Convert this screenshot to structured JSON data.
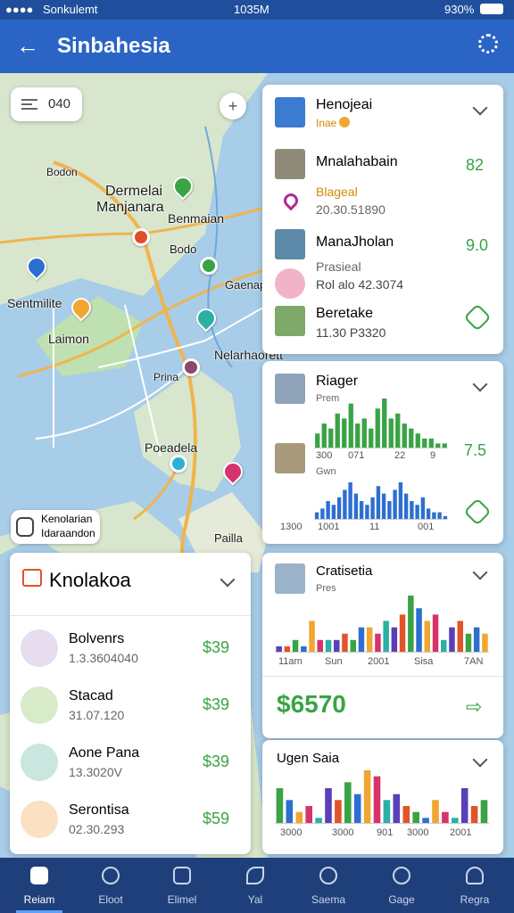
{
  "status_bar": {
    "carrier": "Sonkulemt",
    "time": "1035M",
    "battery": "930%"
  },
  "header": {
    "title": "Sinbahesia"
  },
  "map": {
    "search_text": "040",
    "labels": [
      "Bodon",
      "Dermelai",
      "Manjanara",
      "Benmaian",
      "Bodo",
      "Gaenapa",
      "Sentmilite",
      "Laimon",
      "Nelarhaorett",
      "Prina",
      "Poeadela",
      "Pailla"
    ],
    "layer_chip": {
      "line1": "Kenolarian",
      "line2": "Idaraandon"
    }
  },
  "place_card": {
    "title": "Henojeai",
    "subtitle": "Inae",
    "items": [
      {
        "name": "Mnalahabain",
        "value": "82"
      },
      {
        "name": "Blageal",
        "detail": "20.30.51890"
      },
      {
        "name": "ManaJholan",
        "value": "9.0"
      },
      {
        "name": "Prasieal",
        "detail": "Rol alo 42.3074"
      },
      {
        "name": "Beretake",
        "detail": "11.30 P3320"
      }
    ]
  },
  "stats_card": {
    "title": "Riager",
    "sub1": "Prem",
    "axis1": [
      "300",
      "071",
      "22",
      "9"
    ],
    "sub2": "Gwn",
    "axis2": [
      "1300",
      "1001",
      "11",
      "001"
    ],
    "value": "7.5"
  },
  "list_card": {
    "title": "Knolakoa",
    "items": [
      {
        "name": "Bolvenrs",
        "detail": "1.3.3604040",
        "price": "$39"
      },
      {
        "name": "Stacad",
        "detail": "31.07.120",
        "price": "$39"
      },
      {
        "name": "Aone Pana",
        "detail": "13.3020V",
        "price": "$39"
      },
      {
        "name": "Serontisa",
        "detail": "02.30.293",
        "price": "$59"
      }
    ]
  },
  "chart_card": {
    "title": "Cratisetia",
    "subtitle": "Pres",
    "axis": [
      "11am",
      "Sun",
      "2001",
      "Sisa",
      "7AN"
    ],
    "total": "$6570"
  },
  "mini_chart_card": {
    "title": "Ugen Saia",
    "axis": [
      "3000",
      "3000",
      "901",
      "3000",
      "2001"
    ]
  },
  "chart_data": [
    {
      "type": "bar",
      "title": "Riager",
      "series": [
        {
          "values": [
            3,
            5,
            4,
            7,
            6,
            9,
            5,
            6,
            4,
            8,
            10,
            6,
            7,
            5,
            4,
            3,
            2,
            2,
            1,
            1
          ]
        }
      ]
    },
    {
      "type": "bar",
      "title": "",
      "series": [
        {
          "values": [
            2,
            3,
            5,
            4,
            6,
            8,
            10,
            7,
            5,
            4,
            6,
            9,
            7,
            5,
            8,
            10,
            7,
            5,
            4,
            6,
            3,
            2,
            2,
            1
          ]
        }
      ]
    },
    {
      "type": "bar",
      "title": "Cratisetia",
      "series": [
        {
          "values": [
            1,
            1,
            2,
            1,
            5,
            2,
            2,
            2,
            3,
            2,
            4,
            4,
            3,
            5,
            4,
            6,
            9,
            7,
            5,
            6,
            2,
            4,
            5,
            3,
            4,
            3
          ]
        }
      ]
    },
    {
      "type": "bar",
      "title": "Ugen Saia",
      "series": [
        {
          "values": [
            6,
            4,
            2,
            3,
            1,
            6,
            4,
            7,
            5,
            9,
            8,
            4,
            5,
            3,
            2,
            1,
            4,
            2,
            1,
            6,
            3,
            4
          ]
        }
      ]
    }
  ],
  "bottom_nav": [
    {
      "label": "Reiam"
    },
    {
      "label": "Eloot"
    },
    {
      "label": "Elimel"
    },
    {
      "label": "Yal"
    },
    {
      "label": "Saema"
    },
    {
      "label": "Gage"
    },
    {
      "label": "Regra"
    }
  ]
}
